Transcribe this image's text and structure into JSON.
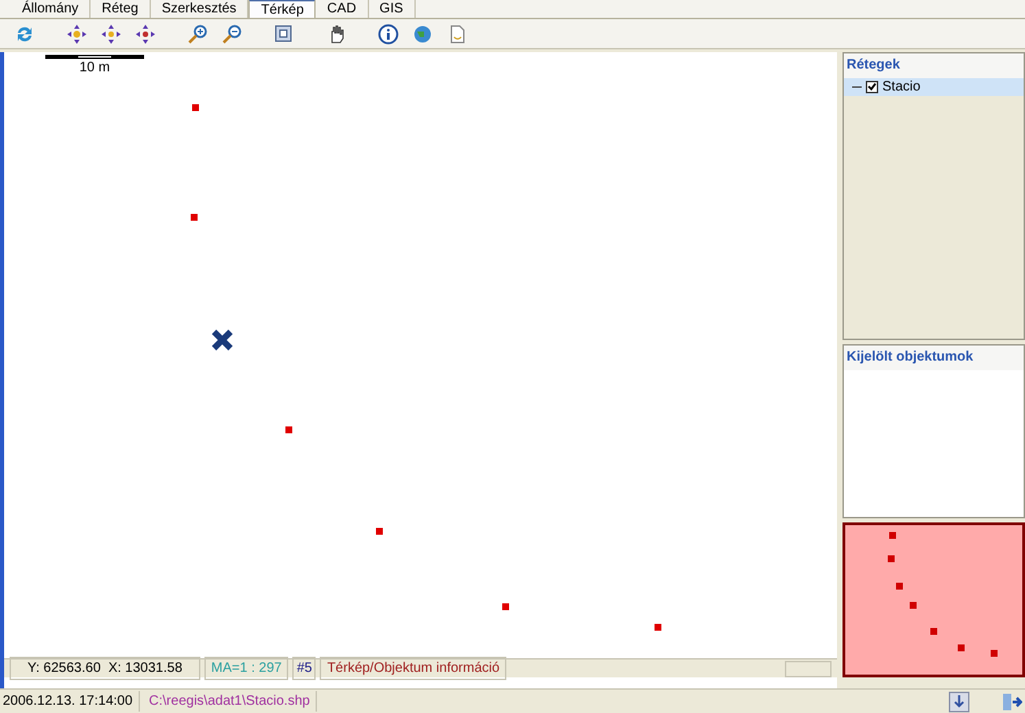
{
  "tabs": [
    {
      "label": "Állomány",
      "selected": false
    },
    {
      "label": "Réteg",
      "selected": false
    },
    {
      "label": "Szerkesztés",
      "selected": false
    },
    {
      "label": "Térkép",
      "selected": true
    },
    {
      "label": "CAD",
      "selected": false
    },
    {
      "label": "GIS",
      "selected": false
    }
  ],
  "map": {
    "scale_label": "10 m"
  },
  "layers_panel": {
    "title": "Rétegek",
    "layers": [
      {
        "name": "Stacio",
        "checked": true,
        "expanded": true
      }
    ]
  },
  "selected_panel": {
    "title": "Kijelölt objektumok"
  },
  "map_status": {
    "coords": "Y: 62563.60  X: 13031.58",
    "scale": "MA=1 : 297",
    "layer_no": "#5",
    "mode": "Térkép/Objektum információ"
  },
  "status_bar": {
    "datetime": "2006.12.13. 17:14:00",
    "file": "C:\\reegis\\adat1\\Stacio.shp"
  }
}
